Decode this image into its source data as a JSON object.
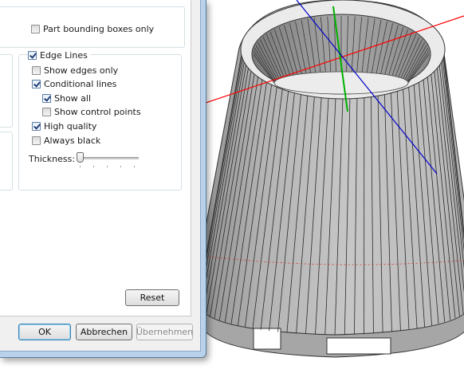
{
  "dialog": {
    "part_bounding_boxes_only": {
      "label": "Part bounding boxes only",
      "checked": false
    },
    "edge_lines_group": {
      "label": "Edge Lines",
      "checked": true,
      "options": [
        {
          "id": "show-edges-only",
          "label": "Show edges only",
          "checked": false
        },
        {
          "id": "conditional-lines",
          "label": "Conditional lines",
          "checked": true
        },
        {
          "id": "show-all",
          "label": "Show all",
          "checked": true
        },
        {
          "id": "show-control-points",
          "label": "Show control points",
          "checked": false
        },
        {
          "id": "high-quality",
          "label": "High quality",
          "checked": true
        },
        {
          "id": "always-black",
          "label": "Always black",
          "checked": false
        }
      ],
      "thickness_label": "Thickness:"
    },
    "buttons": {
      "reset": "Reset",
      "ok": "OK",
      "cancel": "Abbrechen",
      "apply": "Übernehmen"
    }
  },
  "viewport": {
    "colors": {
      "face": "#b9b9b9",
      "face_dark": "#8f8f8f",
      "rim": "#e6e6e6",
      "x_axis": "#ff0000",
      "y_axis": "#00b000",
      "z_axis": "#0000ff"
    }
  }
}
